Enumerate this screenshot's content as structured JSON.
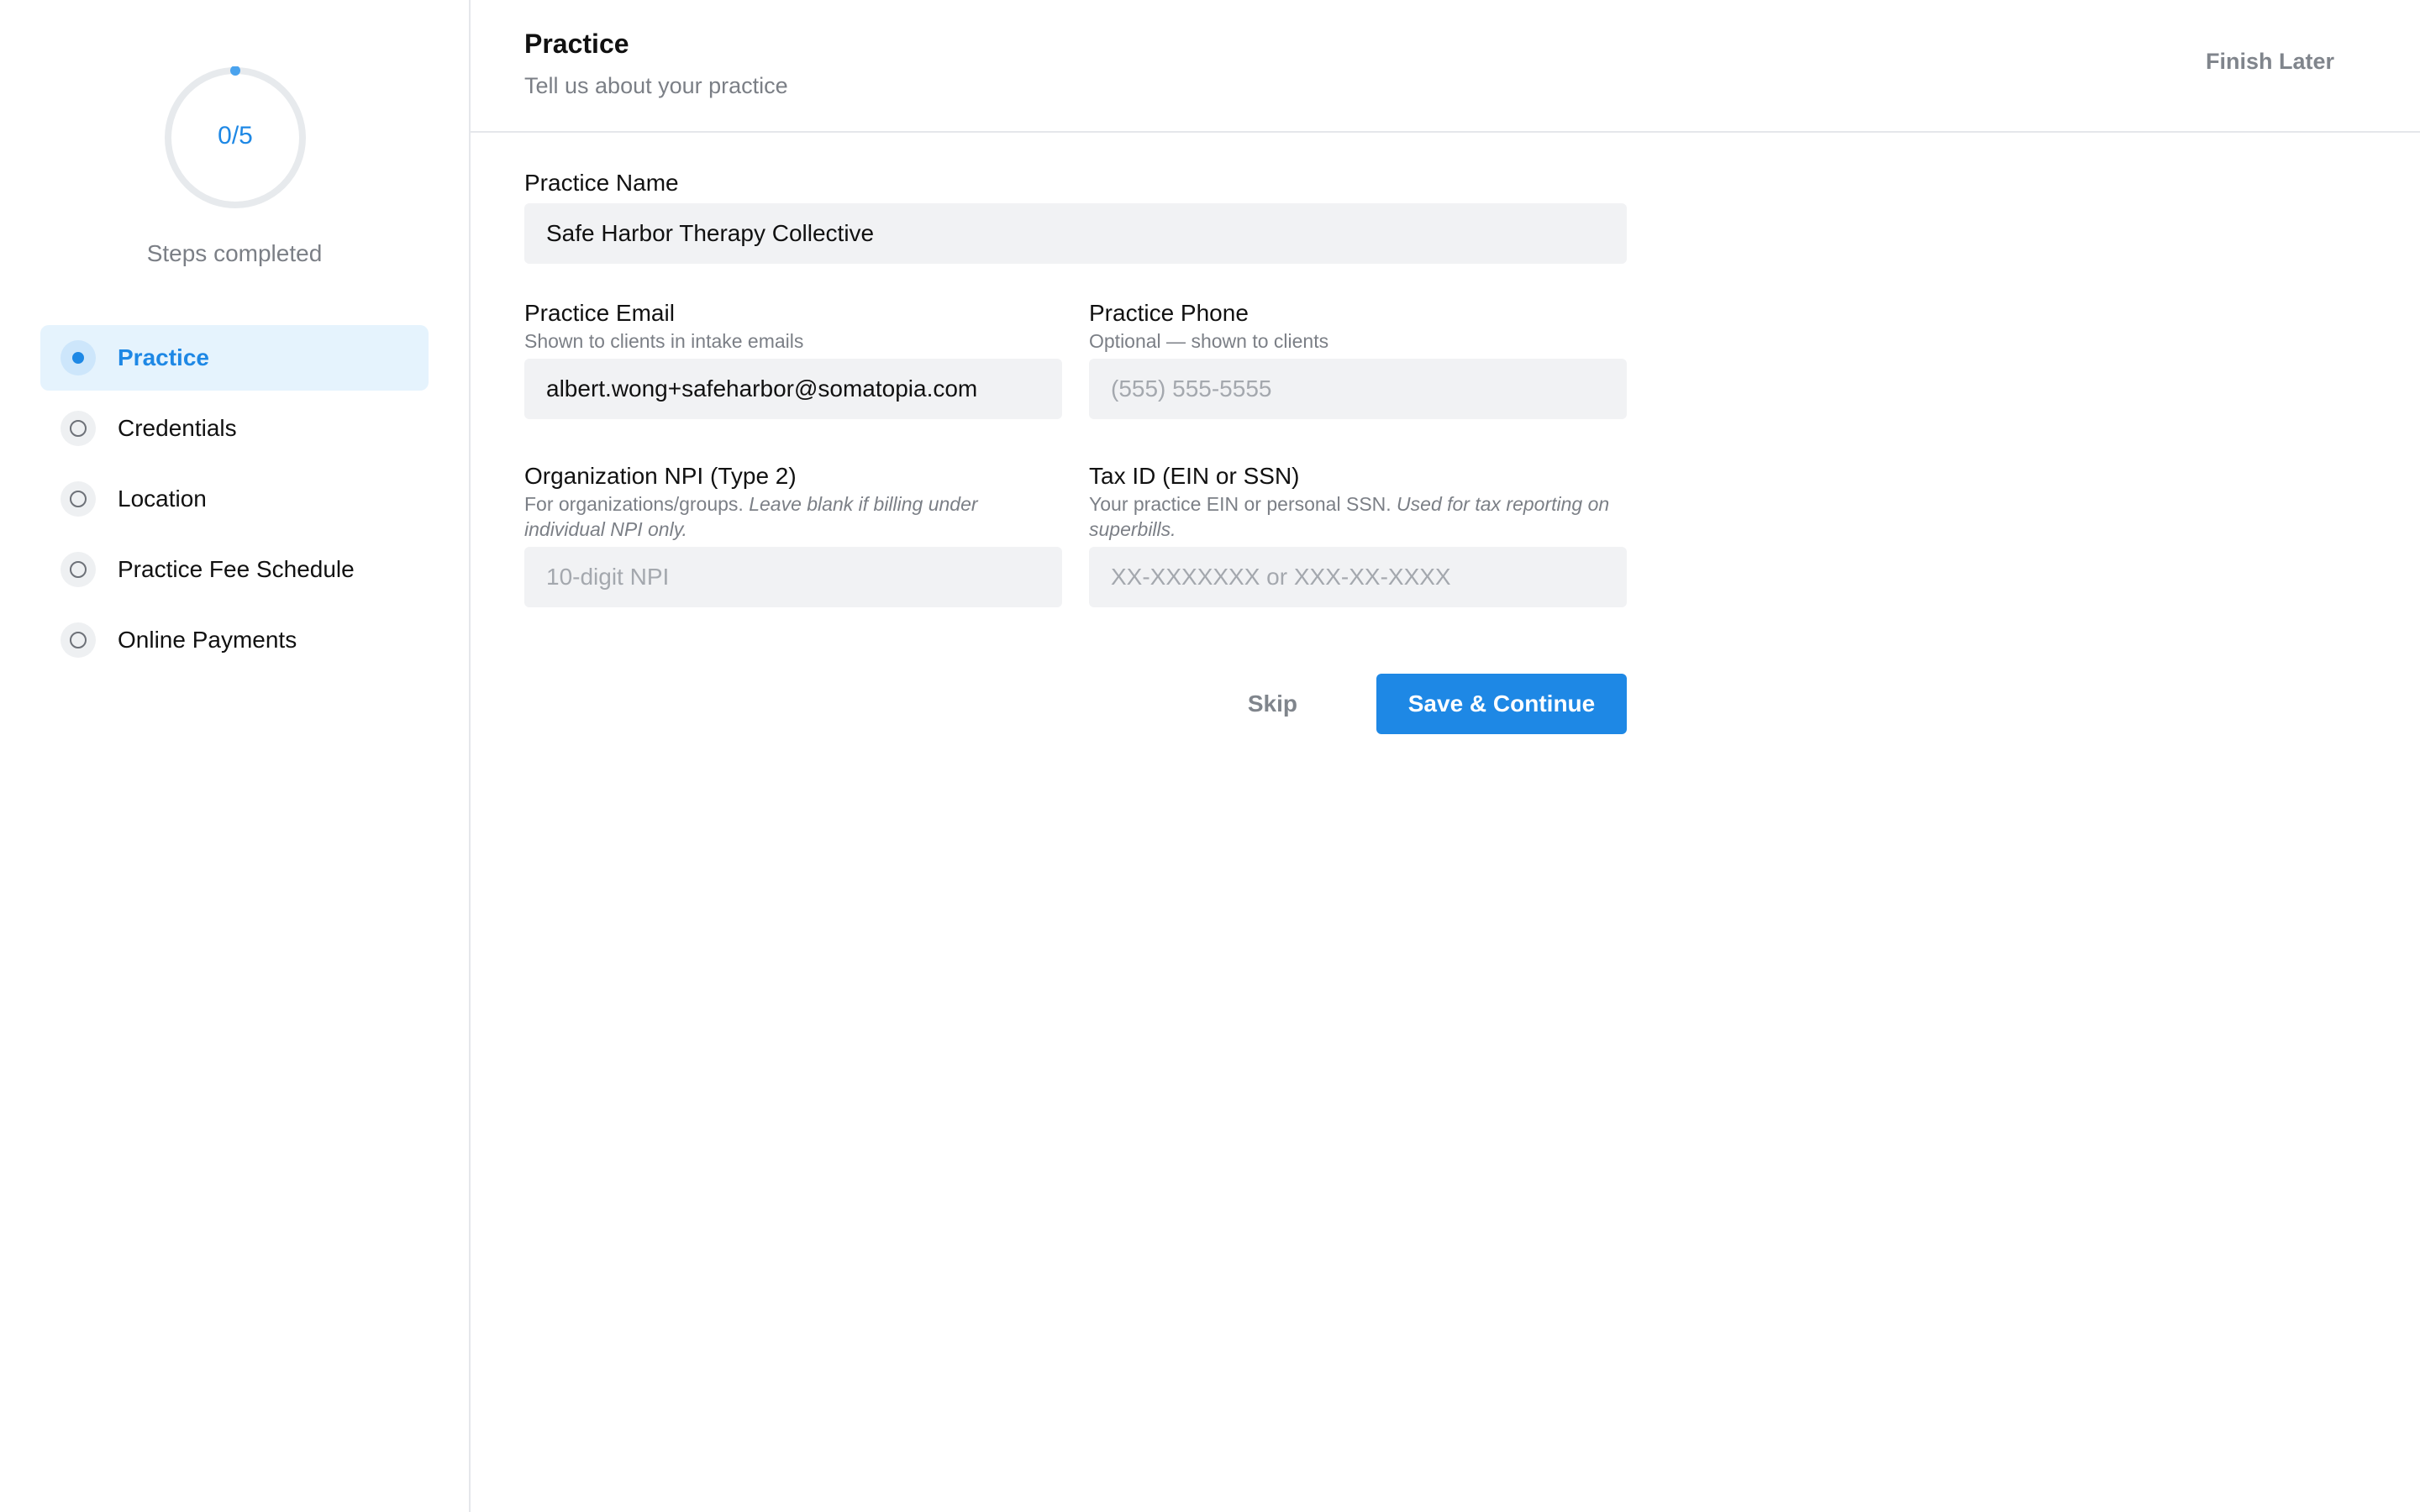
{
  "progress": {
    "text": "0/5",
    "completed": 0,
    "total": 5,
    "caption": "Steps completed",
    "track_color": "#e7eaed",
    "accent_color": "#1e88e5"
  },
  "sidebar": {
    "steps": [
      {
        "label": "Practice",
        "state": "active"
      },
      {
        "label": "Credentials",
        "state": "pending"
      },
      {
        "label": "Location",
        "state": "pending"
      },
      {
        "label": "Practice Fee Schedule",
        "state": "pending"
      },
      {
        "label": "Online Payments",
        "state": "pending"
      }
    ]
  },
  "header": {
    "title": "Practice",
    "subtitle": "Tell us about your practice",
    "finish_later": "Finish Later"
  },
  "form": {
    "practice_name": {
      "label": "Practice Name",
      "value": "Safe Harbor Therapy Collective"
    },
    "practice_email": {
      "label": "Practice Email",
      "hint": "Shown to clients in intake emails",
      "value": "albert.wong+safeharbor@somatopia.com"
    },
    "practice_phone": {
      "label": "Practice Phone",
      "hint": "Optional — shown to clients",
      "placeholder": "(555) 555-5555"
    },
    "organization_npi": {
      "label": "Organization NPI (Type 2)",
      "hint": "For organizations/groups.",
      "hint_italic": "Leave blank if billing under individual NPI only.",
      "placeholder": "10-digit NPI"
    },
    "tax_id": {
      "label": "Tax ID (EIN or SSN)",
      "hint": "Your practice EIN or personal SSN.",
      "hint_italic": "Used for tax reporting on superbills.",
      "placeholder": "XX-XXXXXXX or XXX-XX-XXXX"
    }
  },
  "actions": {
    "skip": "Skip",
    "save": "Save & Continue"
  },
  "colors": {
    "accent": "#1e88e5",
    "active_step_bg": "#e5f3fd",
    "input_bg": "#f1f2f4",
    "muted_text": "#7b7f86"
  }
}
